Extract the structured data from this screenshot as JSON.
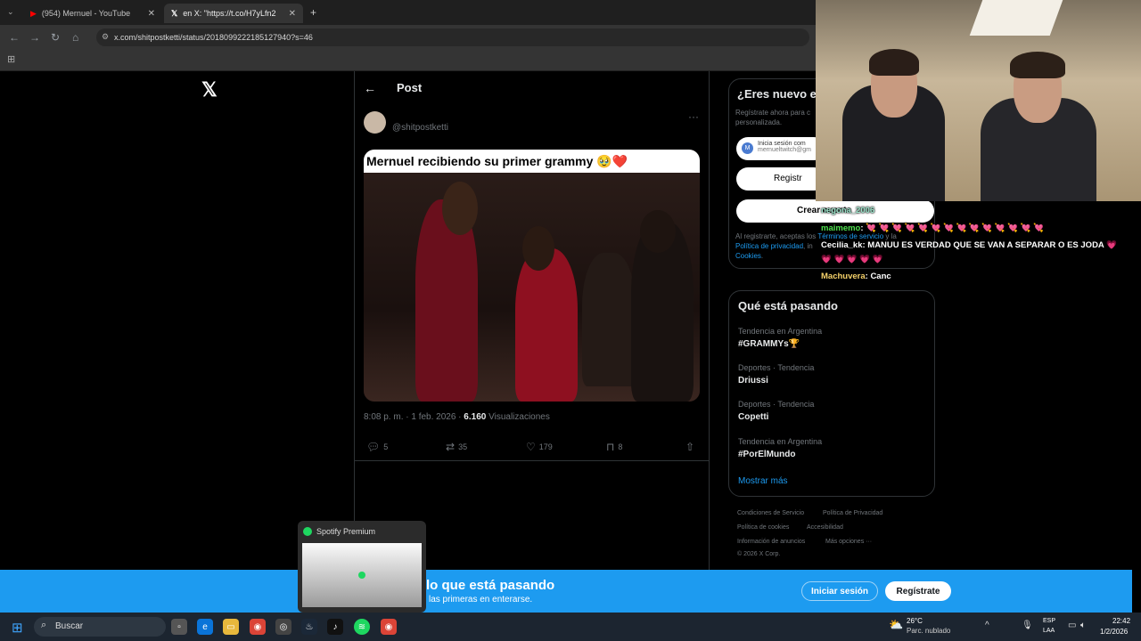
{
  "browser": {
    "tabs": [
      {
        "label": "(954) Mernuel - YouTube"
      },
      {
        "label": "en X: \"https://t.co/H7yLfn2"
      }
    ],
    "new_tab": "+",
    "url": "x.com/shitpostketti/status/2018099222185127940?s=46"
  },
  "post": {
    "header": "Post",
    "handle": "@shitpostketti",
    "caption": "Mernuel recibiendo su primer grammy 🥹❤️",
    "timestamp": "8:08 p. m. · 1 feb. 2026 · ",
    "views_count": "6.160",
    "views_label": " Visualizaciones",
    "replies": "5",
    "reposts": "35",
    "likes": "179",
    "bookmarks": "8"
  },
  "signup": {
    "title": "¿Eres nuevo e",
    "subtitle1": "Regístrate ahora para c",
    "subtitle2": "personalizada.",
    "google_line1": "Inicia sesión com",
    "google_line2": "mernueltwitch@gm",
    "apple_label": "Registr",
    "create_label": "Crear cuenta",
    "legal1": "Al registrarte, aceptas los ",
    "legal_terms": "Términos de servicio",
    "legal1b": " y la",
    "legal_privacy": "Política de privacidad",
    "legal2": ", in",
    "legal_cookies": "Cookies",
    "legal3": "."
  },
  "trends": {
    "title": "Qué está pasando",
    "items": [
      {
        "context": "Tendencia en Argentina",
        "name": "#GRAMMYs🏆"
      },
      {
        "context": "Deportes · Tendencia",
        "name": "Driussi"
      },
      {
        "context": "Deportes · Tendencia",
        "name": "Copetti"
      },
      {
        "context": "Tendencia en Argentina",
        "name": "#PorElMundo"
      }
    ],
    "show_more": "Mostrar más"
  },
  "footer": {
    "l1a": "Condiciones de Servicio",
    "l1b": "Política de Privacidad",
    "l2a": "Política de cookies",
    "l2b": "Accesibilidad",
    "l3a": "Información de anuncios",
    "l3b": "Más opciones ···",
    "copyright": "© 2026 X Corp."
  },
  "stream_chat": [
    {
      "user": "negona_2006",
      "msg": ""
    },
    {
      "user": "maimemo",
      "msg": ": 💘 💘 💘 💘 💘 💘 💘 💘 💘 💘 💘 💘 💘 💘"
    },
    {
      "user": "Cecilia_kk",
      "msg": ": MANUU ES VERDAD QUE SE VAN A SEPARAR O ES JODA 💗"
    },
    {
      "user": "",
      "msg": "💗 💗 💗 💗 💗"
    },
    {
      "user": "Machuvera",
      "msg": ": Canc"
    }
  ],
  "bottom_banner": {
    "headline": "lo que está pasando",
    "sub": "las primeras en enterarse.",
    "login": "Iniciar sesión",
    "register": "Regístrate"
  },
  "spotify_popup": {
    "title": "Spotify Premium"
  },
  "taskbar": {
    "search": "Buscar",
    "temp": "26°C",
    "weather": "Parc. nublado",
    "lang1": "ESP",
    "lang2": "LAA",
    "time": "22:42",
    "date": "1/2/2026"
  },
  "colors": {
    "accent": "#1d9bf0",
    "background": "#000000"
  }
}
